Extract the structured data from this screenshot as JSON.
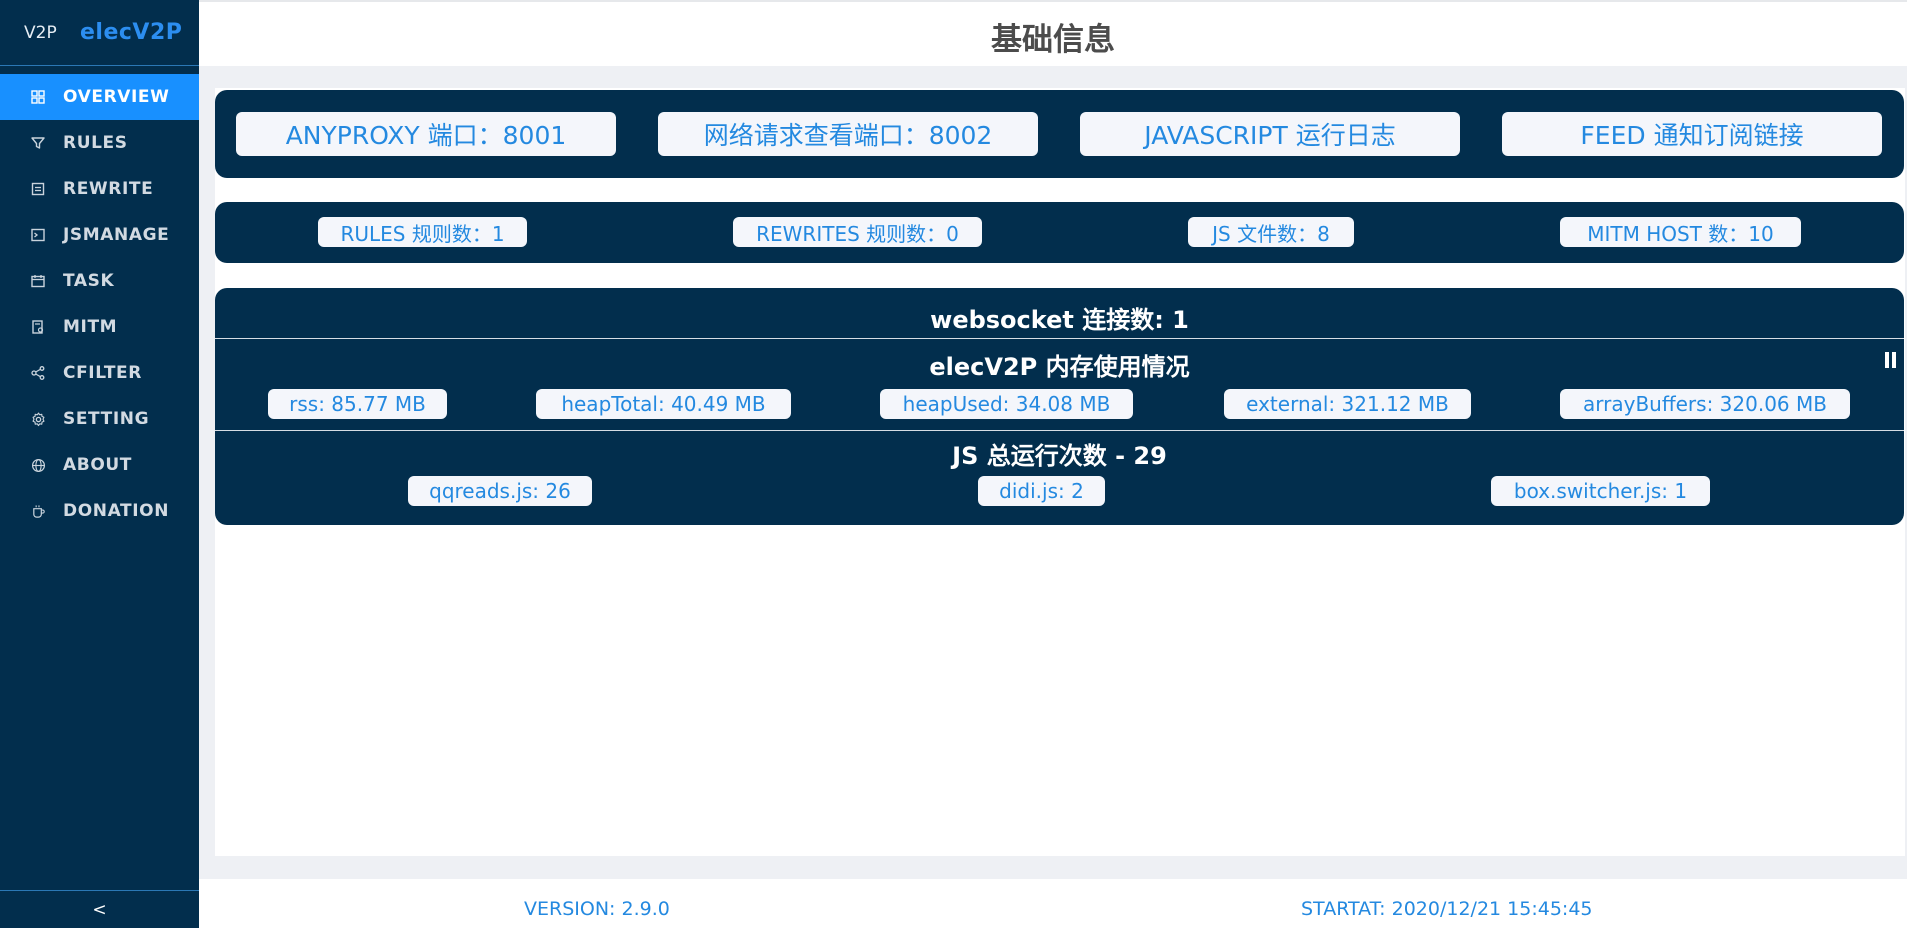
{
  "brand": {
    "mark": "V2P",
    "name": "elecV2P"
  },
  "nav": [
    {
      "label": "OVERVIEW",
      "icon": "grid-icon",
      "active": true
    },
    {
      "label": "RULES",
      "icon": "filter-icon"
    },
    {
      "label": "REWRITE",
      "icon": "document-icon"
    },
    {
      "label": "JSMANAGE",
      "icon": "terminal-icon"
    },
    {
      "label": "TASK",
      "icon": "calendar-icon"
    },
    {
      "label": "MITM",
      "icon": "certificate-icon"
    },
    {
      "label": "CFILTER",
      "icon": "share-icon"
    },
    {
      "label": "SETTING",
      "icon": "gear-icon"
    },
    {
      "label": "ABOUT",
      "icon": "globe-icon"
    },
    {
      "label": "DONATION",
      "icon": "coffee-icon"
    }
  ],
  "collapse": "<",
  "page": {
    "title": "基础信息"
  },
  "links": [
    "ANYPROXY 端口：8001",
    "网络请求查看端口：8002",
    "JAVASCRIPT 运行日志",
    "FEED 通知订阅链接"
  ],
  "counts": [
    "RULES 规则数：1",
    "REWRITES 规则数：0",
    "JS 文件数：8",
    "MITM HOST 数：10"
  ],
  "websocket": {
    "title": "websocket 连接数: 1"
  },
  "memory": {
    "title": "elecV2P 内存使用情况",
    "items": [
      "rss: 85.77 MB",
      "heapTotal: 40.49 MB",
      "heapUsed: 34.08 MB",
      "external: 321.12 MB",
      "arrayBuffers: 320.06 MB"
    ]
  },
  "jsruns": {
    "title": "JS 总运行次数 - 29",
    "items": [
      "qqreads.js: 26",
      "didi.js: 2",
      "box.switcher.js: 1"
    ]
  },
  "footer": {
    "version": "VERSION: 2.9.0",
    "startat": "STARTAT: 2020/12/21 15:45:45"
  }
}
